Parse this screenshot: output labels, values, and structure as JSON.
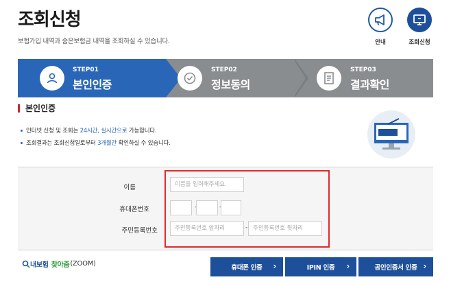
{
  "header": {
    "title": "조회신청",
    "description": "보험가입 내역과 숨은보험금 내역을 조회하실 수 있습니다.",
    "guide_label": "안내",
    "apply_label": "조회신청"
  },
  "steps": [
    {
      "no": "STEP01",
      "name": "본인인증",
      "icon": "person-icon",
      "active": true
    },
    {
      "no": "STEP02",
      "name": "정보동의",
      "icon": "check-circle-icon",
      "active": false
    },
    {
      "no": "STEP03",
      "name": "결과확인",
      "icon": "document-icon",
      "active": false
    }
  ],
  "section": {
    "title": "본인인증",
    "notices": [
      {
        "pre": "인터넷 신청 및 조회는 ",
        "hl": "24시간, 실시간으로",
        "post": " 가능합니다."
      },
      {
        "pre": "조회결과는 조회신청일로부터 ",
        "hl": "3개월간",
        "post": " 확인하실 수 있습니다."
      }
    ]
  },
  "form": {
    "name_label": "이름",
    "name_placeholder": "이름을 입력해주세요.",
    "phone_label": "휴대폰번호",
    "phone_sep": "-",
    "rrn_label": "주민등록번호",
    "rrn_front_placeholder": "주민등록번호 앞자리",
    "rrn_sep": "-",
    "rrn_back_placeholder": "주민등록번호 뒷자리"
  },
  "footer": {
    "zoom_prefix": "내보험",
    "zoom_main": "찾아줌",
    "zoom_suffix": "(ZOOM)",
    "buttons": {
      "phone": "휴대폰 인증",
      "ipin": "IPIN 인증",
      "cert": "공인인증서 인증"
    },
    "chevron": "›"
  },
  "colors": {
    "primary": "#1d4f9a",
    "step_active": "#2a66b8",
    "step_inactive": "#8a8d90",
    "highlight_border": "#e02a2a"
  }
}
